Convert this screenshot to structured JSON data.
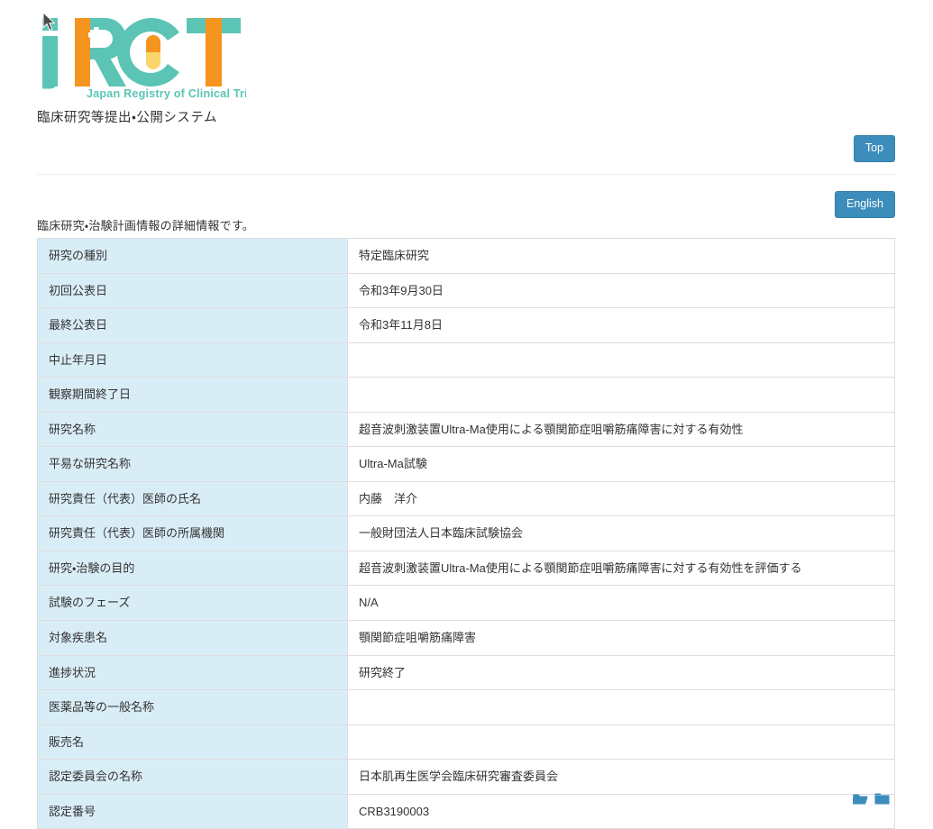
{
  "site": {
    "logo_letters": "jRCT",
    "logo_tagline": "Japan Registry of Clinical Trials",
    "subtitle": "臨床研究等提出・公開システム",
    "brand_teal": "#5bc4b4",
    "brand_orange": "#f5941f",
    "brand_yellow": "#fbd46c",
    "button_blue": "#3c8dbc"
  },
  "buttons": {
    "top_label": "Top",
    "english_label": "English"
  },
  "main": {
    "lead": "臨床研究・治験計画情報の詳細情報です。",
    "rows": [
      {
        "label": "研究の種別",
        "value": "特定臨床研究"
      },
      {
        "label": "初回公表日",
        "value": "令和3年9月30日"
      },
      {
        "label": "最終公表日",
        "value": "令和3年11月8日"
      },
      {
        "label": "中止年月日",
        "value": ""
      },
      {
        "label": "観察期間終了日",
        "value": ""
      },
      {
        "label": "研究名称",
        "value": "超音波刺激装置Ultra-Ma使用による顎関節症咀嚼筋痛障害に対する有効性"
      },
      {
        "label": "平易な研究名称",
        "value": "Ultra-Ma試験"
      },
      {
        "label": "研究責任（代表）医師の氏名",
        "value": "内藤　洋介"
      },
      {
        "label": "研究責任（代表）医師の所属機関",
        "value": "一般財団法人日本臨床試験協会"
      },
      {
        "label": "研究・治験の目的",
        "value": "超音波刺激装置Ultra-Ma使用による顎関節症咀嚼筋痛障害に対する有効性を評価する"
      },
      {
        "label": "試験のフェーズ",
        "value": "N/A"
      },
      {
        "label": "対象疾患名",
        "value": "顎関節症咀嚼筋痛障害"
      },
      {
        "label": "進捗状況",
        "value": "研究終了"
      },
      {
        "label": "医薬品等の一般名称",
        "value": ""
      },
      {
        "label": "販売名",
        "value": ""
      },
      {
        "label": "認定委員会の名称",
        "value": "日本肌再生医学会臨床研究審査委員会"
      },
      {
        "label": "認定番号",
        "value": "CRB3190003"
      }
    ]
  },
  "footer": {
    "icons": [
      {
        "name": "open-folder-icon"
      },
      {
        "name": "closed-folder-icon"
      }
    ]
  }
}
